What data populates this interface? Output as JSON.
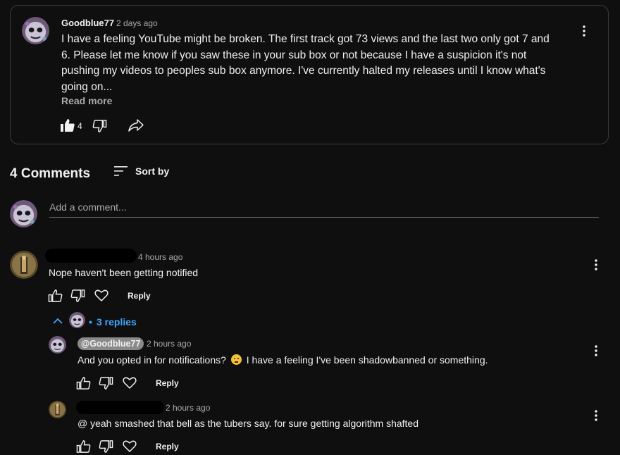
{
  "post": {
    "author": "Goodblue77",
    "time": "2 days ago",
    "text_lines": [
      "I have a feeling YouTube might be broken. The first track got 73 views and the last two only got 7 and",
      "6. Please let me know if you saw these in your sub box or not because I have a suspicion it's not",
      "pushing my videos to peoples sub box anymore. I've currently halted my releases until I know what's",
      "going on..."
    ],
    "read_more": "Read more",
    "likes": "4"
  },
  "comments_header": {
    "count_label": "4 Comments",
    "sort_label": "Sort by"
  },
  "add_comment": {
    "placeholder": "Add a comment..."
  },
  "comments": [
    {
      "time": "4 hours ago",
      "text": "Nope haven't been getting notified",
      "reply_label": "Reply",
      "replies_toggle": "3 replies",
      "replies_prefix": "•"
    }
  ],
  "replies": [
    {
      "mention": "@Goodblue77",
      "time": "2 hours ago",
      "text_before": "And you opted in for notifications?",
      "emoji": "thinking-face",
      "text_after": "I have a feeling I've been shadowbanned or something.",
      "reply_label": "Reply"
    },
    {
      "time": "2 hours ago",
      "text": "@ yeah smashed that bell as the tubers say. for sure getting algorithm shafted",
      "reply_label": "Reply"
    }
  ],
  "colors": {
    "background": "#0f0f0f",
    "link_blue": "#3ea6ff",
    "muted_text": "#aaaaaa"
  }
}
